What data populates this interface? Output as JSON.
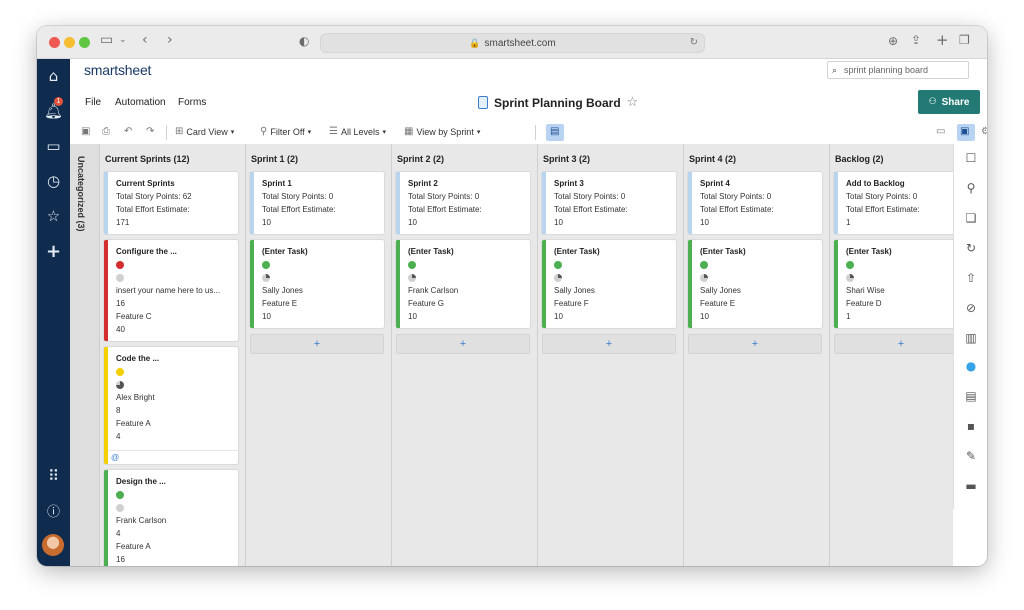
{
  "browser": {
    "url": "smartsheet.com",
    "traffic_lights": [
      "#ee5a52",
      "#f5bd2f",
      "#5ec640"
    ]
  },
  "app": {
    "logo": "smartsheet",
    "search_placeholder": "sprint planning board",
    "menu": [
      "File",
      "Automation",
      "Forms"
    ],
    "sheet_title": "Sprint Planning Board",
    "share_label": "Share",
    "notification_count": "1"
  },
  "toolbar": {
    "card_view": "Card View",
    "filter": "Filter Off",
    "levels": "All Levels",
    "view_by": "View by Sprint"
  },
  "colors": {
    "nav_bg": "#0f2b4e",
    "share": "#237a74",
    "green": "#4caf50",
    "red": "#d32f2f",
    "yellow": "#f5d000",
    "summary": "#b8d4ee"
  },
  "board": {
    "uncategorized": "Uncategorized (3)",
    "columns": [
      {
        "title": "Current Sprints (12)",
        "cards": [
          {
            "title": "Current Sprints",
            "lines": [
              "Total Story Points: 62",
              "Total Effort Estimate:",
              "171"
            ],
            "bar": "summary"
          },
          {
            "title": "Configure the ...",
            "status": "red",
            "progress": "empty",
            "lines": [
              "insert your name here to us...",
              "16",
              "Feature C",
              "40"
            ],
            "bar": "red"
          },
          {
            "title": "Code the ...",
            "status": "yellow",
            "progress": "three-quarter",
            "lines": [
              "Alex Bright",
              "8",
              "Feature A",
              "4"
            ],
            "bar": "yellow",
            "footer": "@"
          },
          {
            "title": "Design the ...",
            "status": "green",
            "progress": "empty",
            "lines": [
              "Frank Carlson",
              "4",
              "Feature A",
              "16"
            ],
            "bar": "green"
          }
        ]
      },
      {
        "title": "Sprint 1 (2)",
        "cards": [
          {
            "title": "Sprint 1",
            "lines": [
              "Total Story Points: 0",
              "Total Effort Estimate:",
              "10"
            ],
            "bar": "summary"
          },
          {
            "title": "(Enter Task)",
            "status": "green",
            "progress": "quarter",
            "lines": [
              "Sally Jones",
              "Feature E",
              "10"
            ],
            "bar": "green"
          }
        ]
      },
      {
        "title": "Sprint 2 (2)",
        "cards": [
          {
            "title": "Sprint 2",
            "lines": [
              "Total Story Points: 0",
              "Total Effort Estimate:",
              "10"
            ],
            "bar": "summary"
          },
          {
            "title": "(Enter Task)",
            "status": "green",
            "progress": "quarter",
            "lines": [
              "Frank Carlson",
              "Feature G",
              "10"
            ],
            "bar": "green"
          }
        ]
      },
      {
        "title": "Sprint 3 (2)",
        "cards": [
          {
            "title": "Sprint 3",
            "lines": [
              "Total Story Points: 0",
              "Total Effort Estimate:",
              "10"
            ],
            "bar": "summary"
          },
          {
            "title": "(Enter Task)",
            "status": "green",
            "progress": "quarter",
            "lines": [
              "Sally Jones",
              "Feature F",
              "10"
            ],
            "bar": "green"
          }
        ]
      },
      {
        "title": "Sprint 4 (2)",
        "cards": [
          {
            "title": "Sprint 4",
            "lines": [
              "Total Story Points: 0",
              "Total Effort Estimate:",
              "10"
            ],
            "bar": "summary"
          },
          {
            "title": "(Enter Task)",
            "status": "green",
            "progress": "quarter",
            "lines": [
              "Sally Jones",
              "Feature E",
              "10"
            ],
            "bar": "green"
          }
        ]
      },
      {
        "title": "Backlog (2)",
        "cards": [
          {
            "title": "Add to Backlog",
            "lines": [
              "Total Story Points: 0",
              "Total Effort Estimate:",
              "1"
            ],
            "bar": "summary"
          },
          {
            "title": "(Enter Task)",
            "status": "green",
            "progress": "quarter",
            "lines": [
              "Shari Wise",
              "Feature D",
              "1"
            ],
            "bar": "green"
          }
        ]
      }
    ],
    "add_label": "+"
  },
  "right_panel_icons": [
    "comment-icon",
    "attachment-icon",
    "proofing-icon",
    "activity-log-icon",
    "publish-icon",
    "update-requests-icon",
    "summary-icon",
    "bulb-icon",
    "reports-icon",
    "apps-icon",
    "pushpin-icon",
    "dashboard-icon"
  ]
}
